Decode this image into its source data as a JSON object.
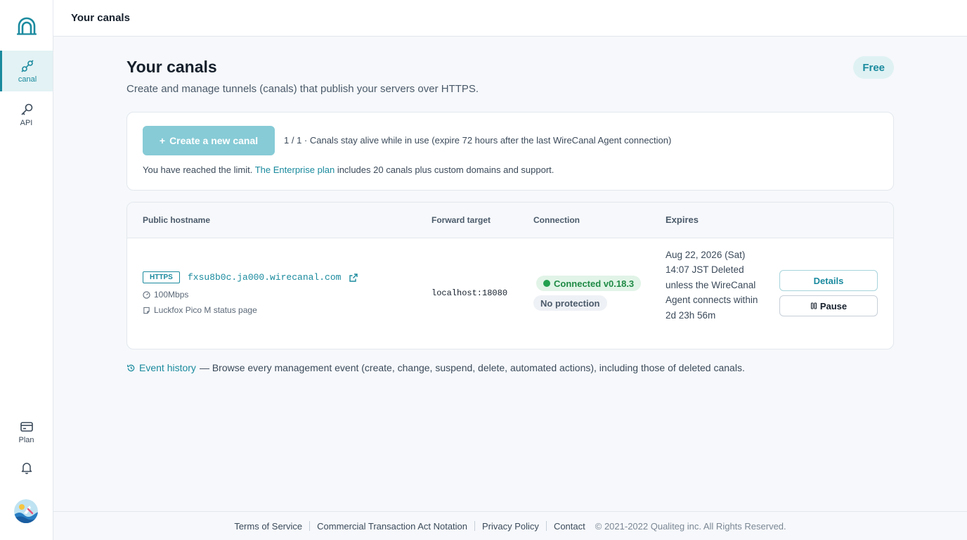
{
  "header": {
    "title": "Your canals"
  },
  "sidebar": {
    "items": [
      {
        "label": "canal",
        "icon": "canal-link-icon",
        "active": true
      },
      {
        "label": "API",
        "icon": "key-icon"
      },
      {
        "label": "Plan",
        "icon": "card-icon"
      },
      {
        "label": "",
        "icon": "bell-icon"
      }
    ]
  },
  "page": {
    "title": "Your canals",
    "subtitle": "Create and manage tunnels (canals) that publish your servers over HTTPS.",
    "plan_badge": "Free"
  },
  "create": {
    "button_label": "Create a new canal",
    "info": "1 / 1 · Canals stay alive while in use (expire 72 hours after the last WireCanal Agent connection)",
    "limit_prefix": "You have reached the limit.",
    "limit_link": "The Enterprise plan",
    "limit_suffix": "includes 20 canals plus custom domains and support."
  },
  "table": {
    "headers": {
      "hostname": "Public hostname",
      "forward": "Forward target",
      "connection": "Connection",
      "expires": "Expires"
    },
    "rows": [
      {
        "protocol": "HTTPS",
        "hostname": "fxsu8b0c.ja000.wirecanal.com",
        "bandwidth": "100Mbps",
        "note": "Luckfox Pico M status page",
        "forward_target": "localhost:18080",
        "status": "Connected v0.18.3",
        "protection": "No protection",
        "expires": "Aug 22, 2026 (Sat) 14:07 JST Deleted unless the WireCanal Agent connects within 2d 23h 56m",
        "details_label": "Details",
        "pause_label": "Pause"
      }
    ]
  },
  "event_history": {
    "link": "Event history",
    "text": "— Browse every management event (create, change, suspend, delete, automated actions), including those of deleted canals."
  },
  "footer": {
    "links": [
      "Terms of Service",
      "Commercial Transaction Act Notation",
      "Privacy Policy",
      "Contact"
    ],
    "copyright": "© 2021-2022 Qualiteg inc. All Rights Reserved."
  },
  "colors": {
    "accent": "#1a8a9e",
    "status_connected": "#22a04e",
    "create_button": "#86cbd6"
  }
}
